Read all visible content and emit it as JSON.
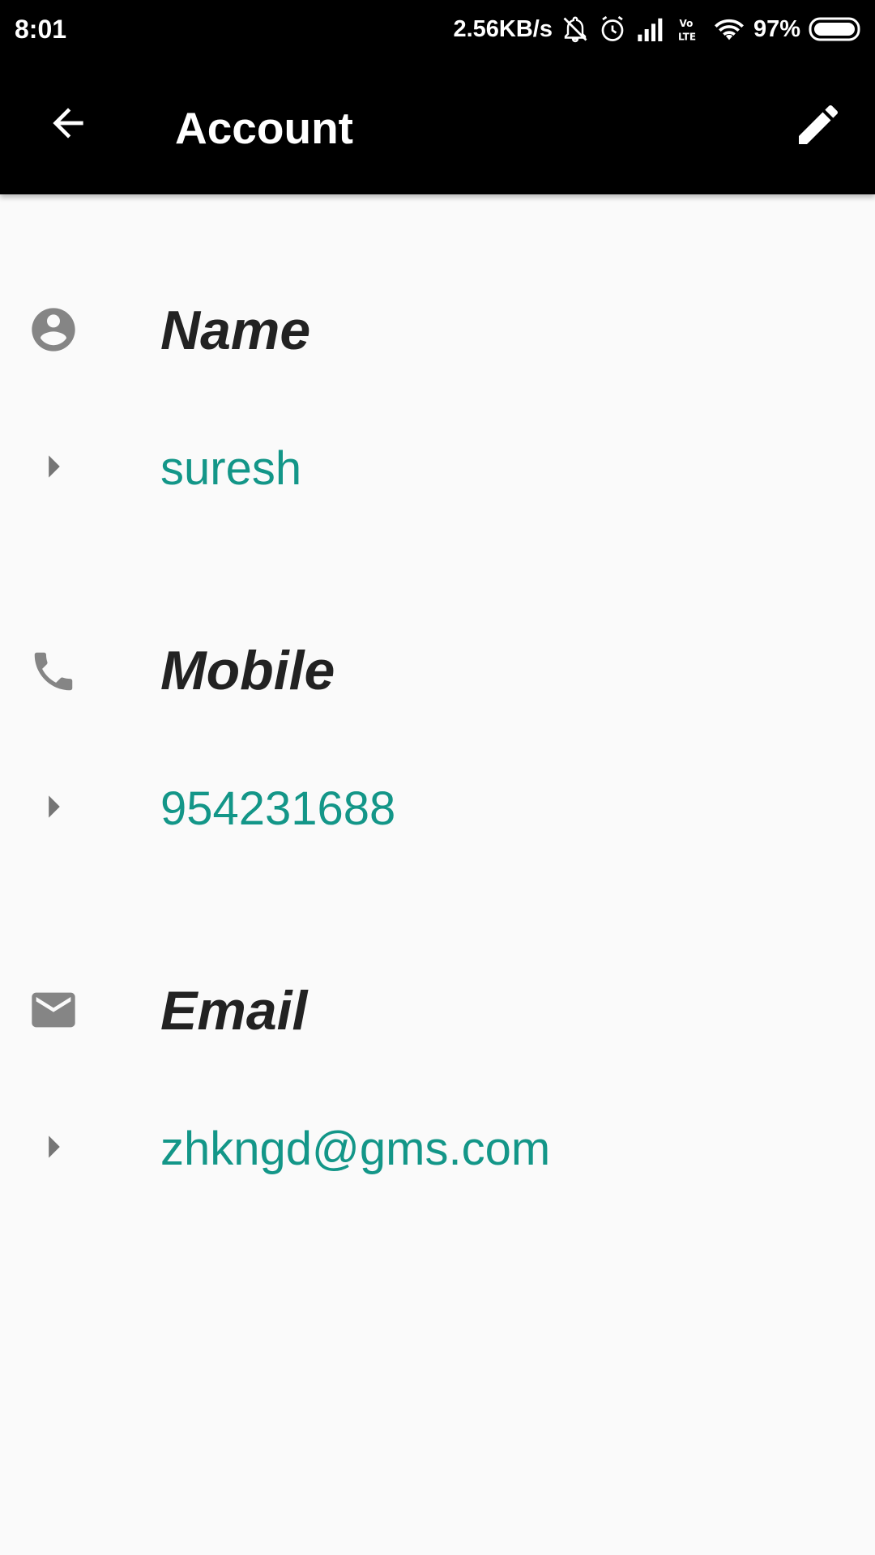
{
  "status_bar": {
    "time": "8:01",
    "network_speed": "2.56KB/s",
    "battery": "97%",
    "icons": [
      "muted-bell-icon",
      "alarm-icon",
      "signal-icon",
      "volte-icon",
      "wifi-icon",
      "battery-icon"
    ]
  },
  "app_bar": {
    "title": "Account",
    "back_icon": "arrow-back-icon",
    "edit_icon": "pencil-icon"
  },
  "fields": {
    "name": {
      "label": "Name",
      "value": "suresh",
      "icon": "account-circle-icon"
    },
    "mobile": {
      "label": "Mobile",
      "value": "954231688",
      "icon": "phone-icon"
    },
    "email": {
      "label": "Email",
      "value": "zhkngd@gms.com",
      "icon": "mail-icon"
    }
  },
  "colors": {
    "value_text": "#139688",
    "label_text": "#222222",
    "icon_gray": "#858585",
    "bar_background": "#000000",
    "page_background": "#fafafa"
  }
}
